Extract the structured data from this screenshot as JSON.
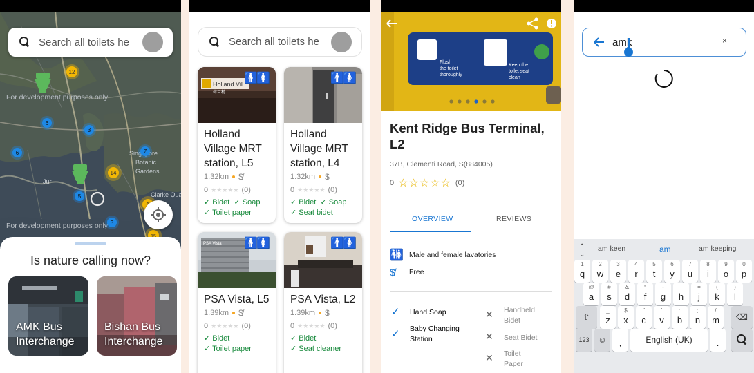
{
  "screen1": {
    "search_placeholder": "Search all toilets he",
    "watermark": "For development purposes only",
    "clusters": [
      "12",
      "6",
      "3",
      "6",
      "7",
      "14",
      "5",
      "3",
      "15",
      "1"
    ],
    "map_labels": [
      "Singapore",
      "Botanic",
      "Gardens",
      "Clarke Qua",
      "Jur"
    ],
    "sheet_title": "Is nature calling now?",
    "cards": [
      {
        "label_line1": "AMK Bus",
        "label_line2": "Interchange"
      },
      {
        "label_line1": "Bishan Bus",
        "label_line2": "Interchange"
      }
    ],
    "icons": {
      "search": "search-icon",
      "toilet_marker": "toilet-marker-icon",
      "locate": "crosshair-icon"
    }
  },
  "screen2": {
    "search_placeholder": "Search all toilets he",
    "cards": [
      {
        "name": "Holland Village MRT station, L5",
        "distance": "1.32km",
        "rating": "0",
        "count": "(0)",
        "features": [
          "Bidet",
          "Soap",
          "Toilet paper"
        ],
        "cost": "free"
      },
      {
        "name": "Holland Village MRT station, L4",
        "distance": "1.32km",
        "rating": "0",
        "count": "(0)",
        "features": [
          "Bidet",
          "Soap",
          "Seat bidet"
        ],
        "cost": "paid"
      },
      {
        "name": "PSA Vista, L5",
        "distance": "1.39km",
        "rating": "0",
        "count": "(0)",
        "features": [
          "Bidet",
          "Toilet paper"
        ],
        "cost": "free"
      },
      {
        "name": "PSA Vista, L2",
        "distance": "1.39km",
        "rating": "0",
        "count": "(0)",
        "features": [
          "Bidet",
          "Seat cleaner"
        ],
        "cost": "paid"
      }
    ],
    "photo_sign": "Holland Vil",
    "photo_sub": "荷兰村"
  },
  "screen3": {
    "hero_sign": {
      "left": [
        "Flush",
        "the toilet",
        "thoroughly"
      ],
      "right": [
        "Keep the",
        "toilet seat",
        "clean"
      ]
    },
    "carousel_dots": 6,
    "carousel_active": 4,
    "title": "Kent Ridge Bus Terminal, L2",
    "address": "37B, Clementi Road, S(884005)",
    "rating": "0",
    "rating_count": "(0)",
    "tabs": [
      "OVERVIEW",
      "REVIEWS"
    ],
    "gender": "Male and female lavatories",
    "cost": "Free",
    "available": [
      "Hand Soap",
      "Baby Changing Station"
    ],
    "unavailable": [
      "Handheld Bidet",
      "Seat Bidet",
      "Toilet Paper"
    ],
    "accent": "#1976d2"
  },
  "screen4": {
    "query": "amk",
    "suggestions": [
      "am keen",
      "am",
      "am keeping"
    ],
    "row1": [
      [
        "1",
        "q"
      ],
      [
        "2",
        "w"
      ],
      [
        "3",
        "e"
      ],
      [
        "4",
        "r"
      ],
      [
        "5",
        "t"
      ],
      [
        "6",
        "y"
      ],
      [
        "7",
        "u"
      ],
      [
        "8",
        "i"
      ],
      [
        "9",
        "o"
      ],
      [
        "0",
        "p"
      ]
    ],
    "row2": [
      [
        "@",
        "a"
      ],
      [
        "#",
        "s"
      ],
      [
        "&",
        "d"
      ],
      [
        "*",
        "f"
      ],
      [
        "-",
        "g"
      ],
      [
        "+",
        "h"
      ],
      [
        "=",
        "j"
      ],
      [
        "(",
        "k"
      ],
      [
        ")",
        "l"
      ]
    ],
    "row3": [
      [
        "_",
        "z"
      ],
      [
        "$",
        "x"
      ],
      [
        "\"",
        "c"
      ],
      [
        "'",
        "v"
      ],
      [
        ":",
        "b"
      ],
      [
        ";",
        "n"
      ],
      [
        "/",
        "m"
      ]
    ],
    "mode_key": "123",
    "comma": ",",
    "period": ".",
    "space_label": "English (UK)"
  }
}
